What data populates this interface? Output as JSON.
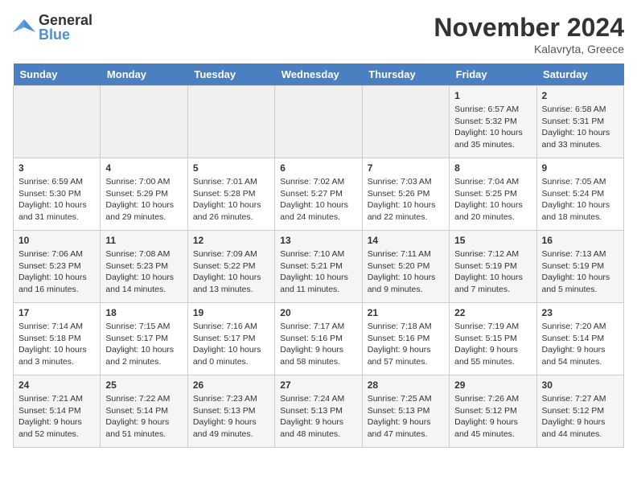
{
  "logo": {
    "general": "General",
    "blue": "Blue"
  },
  "title": "November 2024",
  "location": "Kalavryta, Greece",
  "days_of_week": [
    "Sunday",
    "Monday",
    "Tuesday",
    "Wednesday",
    "Thursday",
    "Friday",
    "Saturday"
  ],
  "weeks": [
    [
      {
        "day": "",
        "info": ""
      },
      {
        "day": "",
        "info": ""
      },
      {
        "day": "",
        "info": ""
      },
      {
        "day": "",
        "info": ""
      },
      {
        "day": "",
        "info": ""
      },
      {
        "day": "1",
        "info": "Sunrise: 6:57 AM\nSunset: 5:32 PM\nDaylight: 10 hours and 35 minutes."
      },
      {
        "day": "2",
        "info": "Sunrise: 6:58 AM\nSunset: 5:31 PM\nDaylight: 10 hours and 33 minutes."
      }
    ],
    [
      {
        "day": "3",
        "info": "Sunrise: 6:59 AM\nSunset: 5:30 PM\nDaylight: 10 hours and 31 minutes."
      },
      {
        "day": "4",
        "info": "Sunrise: 7:00 AM\nSunset: 5:29 PM\nDaylight: 10 hours and 29 minutes."
      },
      {
        "day": "5",
        "info": "Sunrise: 7:01 AM\nSunset: 5:28 PM\nDaylight: 10 hours and 26 minutes."
      },
      {
        "day": "6",
        "info": "Sunrise: 7:02 AM\nSunset: 5:27 PM\nDaylight: 10 hours and 24 minutes."
      },
      {
        "day": "7",
        "info": "Sunrise: 7:03 AM\nSunset: 5:26 PM\nDaylight: 10 hours and 22 minutes."
      },
      {
        "day": "8",
        "info": "Sunrise: 7:04 AM\nSunset: 5:25 PM\nDaylight: 10 hours and 20 minutes."
      },
      {
        "day": "9",
        "info": "Sunrise: 7:05 AM\nSunset: 5:24 PM\nDaylight: 10 hours and 18 minutes."
      }
    ],
    [
      {
        "day": "10",
        "info": "Sunrise: 7:06 AM\nSunset: 5:23 PM\nDaylight: 10 hours and 16 minutes."
      },
      {
        "day": "11",
        "info": "Sunrise: 7:08 AM\nSunset: 5:23 PM\nDaylight: 10 hours and 14 minutes."
      },
      {
        "day": "12",
        "info": "Sunrise: 7:09 AM\nSunset: 5:22 PM\nDaylight: 10 hours and 13 minutes."
      },
      {
        "day": "13",
        "info": "Sunrise: 7:10 AM\nSunset: 5:21 PM\nDaylight: 10 hours and 11 minutes."
      },
      {
        "day": "14",
        "info": "Sunrise: 7:11 AM\nSunset: 5:20 PM\nDaylight: 10 hours and 9 minutes."
      },
      {
        "day": "15",
        "info": "Sunrise: 7:12 AM\nSunset: 5:19 PM\nDaylight: 10 hours and 7 minutes."
      },
      {
        "day": "16",
        "info": "Sunrise: 7:13 AM\nSunset: 5:19 PM\nDaylight: 10 hours and 5 minutes."
      }
    ],
    [
      {
        "day": "17",
        "info": "Sunrise: 7:14 AM\nSunset: 5:18 PM\nDaylight: 10 hours and 3 minutes."
      },
      {
        "day": "18",
        "info": "Sunrise: 7:15 AM\nSunset: 5:17 PM\nDaylight: 10 hours and 2 minutes."
      },
      {
        "day": "19",
        "info": "Sunrise: 7:16 AM\nSunset: 5:17 PM\nDaylight: 10 hours and 0 minutes."
      },
      {
        "day": "20",
        "info": "Sunrise: 7:17 AM\nSunset: 5:16 PM\nDaylight: 9 hours and 58 minutes."
      },
      {
        "day": "21",
        "info": "Sunrise: 7:18 AM\nSunset: 5:16 PM\nDaylight: 9 hours and 57 minutes."
      },
      {
        "day": "22",
        "info": "Sunrise: 7:19 AM\nSunset: 5:15 PM\nDaylight: 9 hours and 55 minutes."
      },
      {
        "day": "23",
        "info": "Sunrise: 7:20 AM\nSunset: 5:14 PM\nDaylight: 9 hours and 54 minutes."
      }
    ],
    [
      {
        "day": "24",
        "info": "Sunrise: 7:21 AM\nSunset: 5:14 PM\nDaylight: 9 hours and 52 minutes."
      },
      {
        "day": "25",
        "info": "Sunrise: 7:22 AM\nSunset: 5:14 PM\nDaylight: 9 hours and 51 minutes."
      },
      {
        "day": "26",
        "info": "Sunrise: 7:23 AM\nSunset: 5:13 PM\nDaylight: 9 hours and 49 minutes."
      },
      {
        "day": "27",
        "info": "Sunrise: 7:24 AM\nSunset: 5:13 PM\nDaylight: 9 hours and 48 minutes."
      },
      {
        "day": "28",
        "info": "Sunrise: 7:25 AM\nSunset: 5:13 PM\nDaylight: 9 hours and 47 minutes."
      },
      {
        "day": "29",
        "info": "Sunrise: 7:26 AM\nSunset: 5:12 PM\nDaylight: 9 hours and 45 minutes."
      },
      {
        "day": "30",
        "info": "Sunrise: 7:27 AM\nSunset: 5:12 PM\nDaylight: 9 hours and 44 minutes."
      }
    ]
  ]
}
